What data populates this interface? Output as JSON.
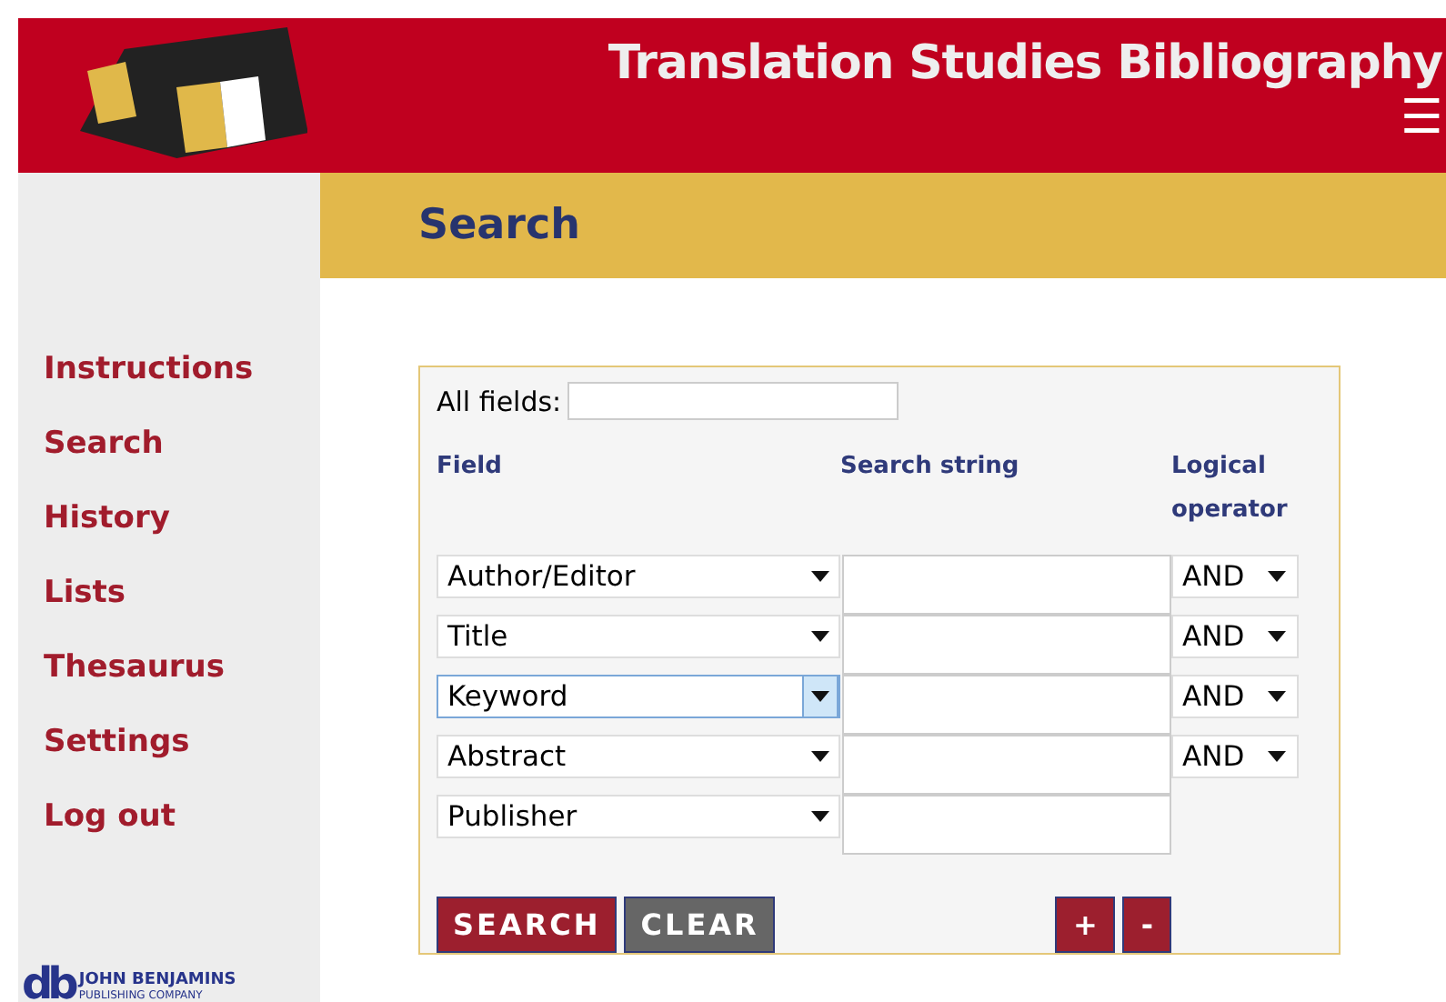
{
  "header": {
    "title": "Translation Studies Bibliography",
    "menu_icon": "☰"
  },
  "page_title": "Search",
  "sidebar": {
    "items": [
      {
        "label": "Instructions"
      },
      {
        "label": "Search"
      },
      {
        "label": "History"
      },
      {
        "label": "Lists"
      },
      {
        "label": "Thesaurus"
      },
      {
        "label": "Settings"
      },
      {
        "label": "Log out"
      }
    ],
    "publisher": {
      "mark": "db",
      "name": "JOHN BENJAMINS",
      "subtitle": "PUBLISHING COMPANY"
    }
  },
  "form": {
    "all_fields_label": "All fields:",
    "columns": [
      "Field",
      "Search string",
      "Logical operator"
    ],
    "rows": [
      {
        "field": "Author/Editor",
        "focused": false,
        "operator": "AND"
      },
      {
        "field": "Title",
        "focused": false,
        "operator": "AND"
      },
      {
        "field": "Keyword",
        "focused": true,
        "operator": "AND"
      },
      {
        "field": "Abstract",
        "focused": false,
        "operator": "AND"
      },
      {
        "field": "Publisher",
        "focused": false
      }
    ],
    "buttons": {
      "search": "SEARCH",
      "clear": "CLEAR",
      "add": "+",
      "remove": "-"
    }
  }
}
